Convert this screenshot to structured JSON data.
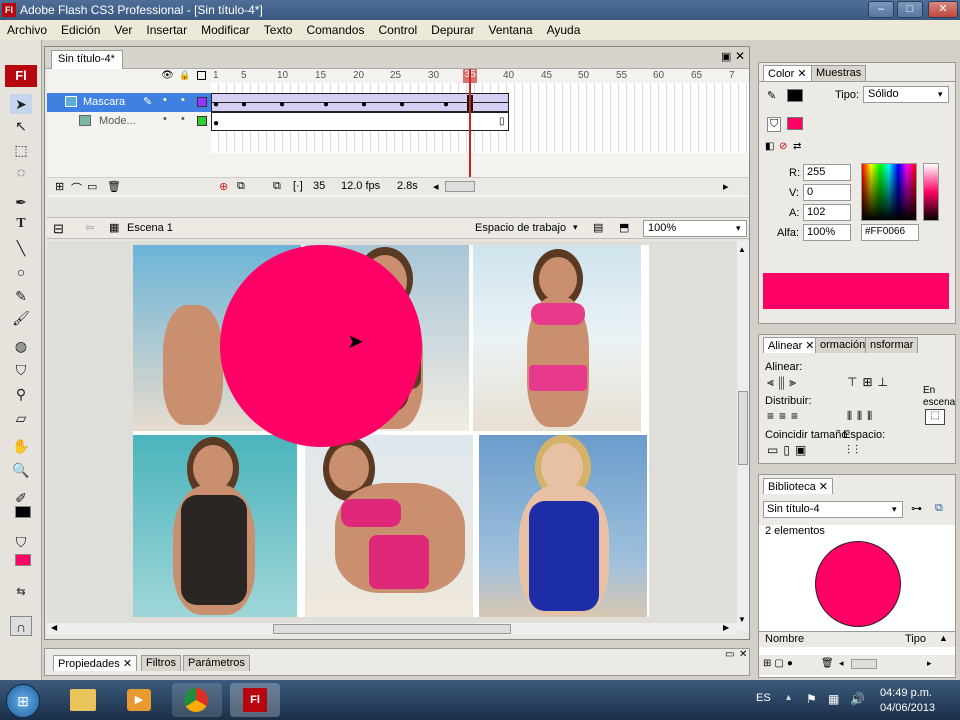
{
  "window": {
    "app_icon": "Fl",
    "title": "Adobe Flash CS3 Professional - [Sin título-4*]",
    "min": "–",
    "max": "□",
    "close": "✕"
  },
  "menu": [
    "Archivo",
    "Edición",
    "Ver",
    "Insertar",
    "Modificar",
    "Texto",
    "Comandos",
    "Control",
    "Depurar",
    "Ventana",
    "Ayuda"
  ],
  "document": {
    "tab_label": "Sin título-4*"
  },
  "timeline": {
    "frame_numbers": [
      "1",
      "5",
      "10",
      "15",
      "20",
      "25",
      "30",
      "35",
      "40",
      "45",
      "50",
      "55",
      "60",
      "65",
      "7"
    ],
    "layers": [
      {
        "name": "Mascara"
      },
      {
        "name": "Mode..."
      }
    ],
    "current_frame": "35",
    "fps": "12.0 fps",
    "time": "2.8s"
  },
  "editbar": {
    "scene": "Escena 1",
    "workspace": "Espacio de trabajo",
    "zoom": "100%"
  },
  "color_panel": {
    "tabs": [
      "Color",
      "Muestras"
    ],
    "type_label": "Tipo:",
    "type_value": "Sólido",
    "r_label": "R:",
    "r_value": "255",
    "g_label": "V:",
    "g_value": "0",
    "b_label": "A:",
    "b_value": "102",
    "alpha_label": "Alfa:",
    "alpha_value": "100%",
    "hex_value": "#FF0066",
    "swatch_color": "#FF0066"
  },
  "align_panel": {
    "tabs": [
      "Alinear",
      "ormación",
      "nsformar"
    ],
    "align_label": "Alinear:",
    "distribute_label": "Distribuir:",
    "match_label": "Coincidir tamaño:",
    "space_label": "Espacio:",
    "stage_label_1": "En",
    "stage_label_2": "escena"
  },
  "library_panel": {
    "tab": "Biblioteca",
    "doc_select": "Sin título-4",
    "count": "2 elementos",
    "col_name": "Nombre",
    "col_type": "Tipo"
  },
  "properties_panel": {
    "tabs": [
      "Propiedades",
      "Filtros",
      "Parámetros"
    ]
  },
  "taskbar": {
    "lang": "ES",
    "time": "04:49 p.m.",
    "date": "04/06/2013",
    "flash_label": "Fl"
  }
}
